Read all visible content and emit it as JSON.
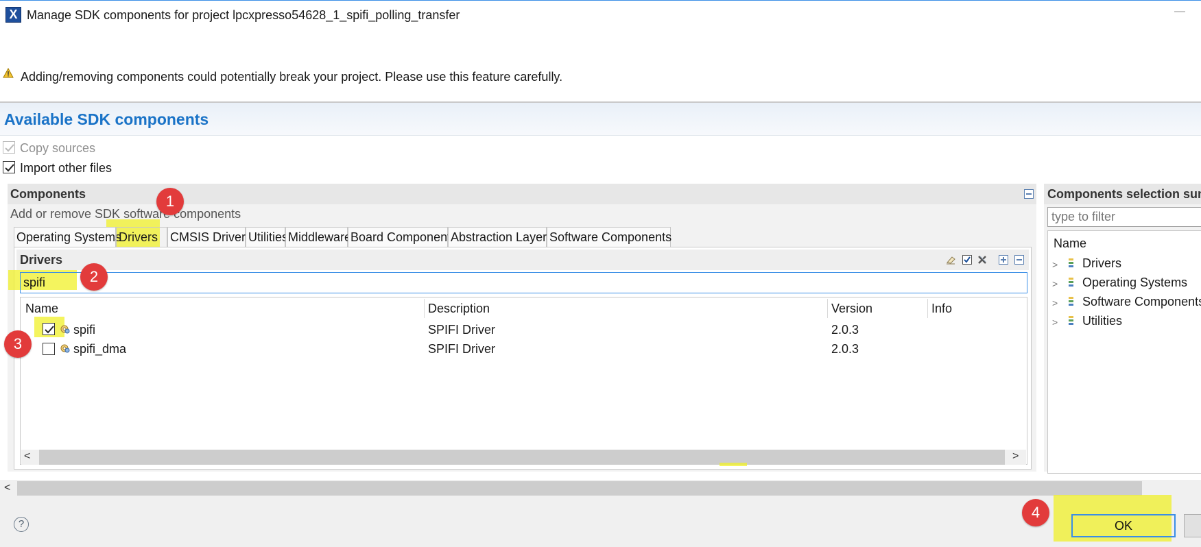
{
  "window": {
    "title": "Manage SDK components for project lpcxpresso54628_1_spifi_polling_transfer",
    "icon": "x-app-icon",
    "minimize_glyph": "—"
  },
  "warning": {
    "text": "Adding/removing components could potentially break your project. Please use this feature carefully.",
    "icon": "warning-icon"
  },
  "section_title": "Available SDK components",
  "options": {
    "copy_sources": {
      "label": "Copy sources",
      "checked": true,
      "disabled": true
    },
    "import_other_files": {
      "label": "Import other files",
      "checked": true
    }
  },
  "components": {
    "title": "Components",
    "subtitle": "Add or remove SDK software components",
    "tabs": [
      {
        "label": "Operating Systems"
      },
      {
        "label": "Drivers",
        "active": true
      },
      {
        "label": "CMSIS Drivers"
      },
      {
        "label": "Utilities"
      },
      {
        "label": "Middleware"
      },
      {
        "label": "Board Components"
      },
      {
        "label": "Abstraction Layer"
      },
      {
        "label": "Software Components"
      }
    ],
    "drivers_title": "Drivers",
    "filter_value": "spifi",
    "columns": [
      "Name",
      "Description",
      "Version",
      "Info"
    ],
    "rows": [
      {
        "name": "spifi",
        "description": "SPIFI Driver",
        "version": "2.0.3",
        "checked": true
      },
      {
        "name": "spifi_dma",
        "description": "SPIFI Driver",
        "version": "2.0.3",
        "checked": false
      }
    ],
    "scroll_left": "<",
    "scroll_right": ">"
  },
  "summary": {
    "title": "Components selection summary",
    "filter_placeholder": "type to filter",
    "column": "Name",
    "items": [
      "Drivers",
      "Operating Systems",
      "Software Components",
      "Utilities"
    ],
    "chevron": ">"
  },
  "bottom": {
    "scroll_left": "<",
    "help": "?",
    "ok": "OK"
  },
  "annotations": [
    "1",
    "2",
    "3",
    "4"
  ],
  "colors": {
    "accent": "#1a73c7",
    "highlight": "#f0f028",
    "marker": "#e23b3b"
  }
}
